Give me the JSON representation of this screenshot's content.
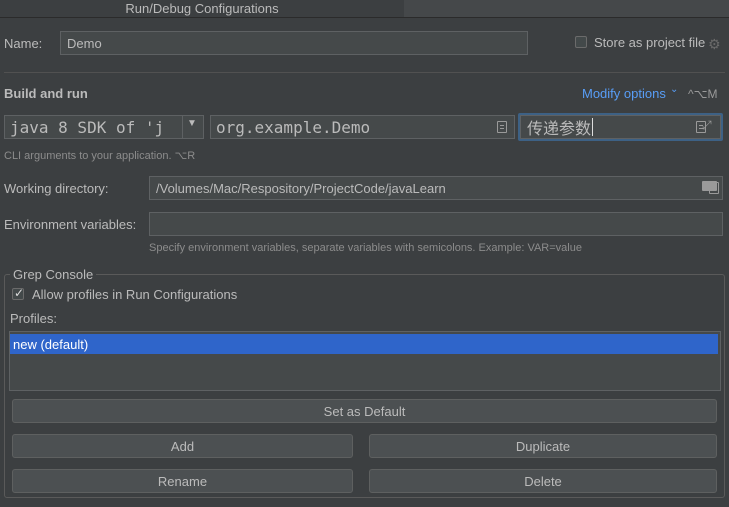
{
  "window": {
    "title": "Run/Debug Configurations"
  },
  "name_row": {
    "label": "Name:",
    "value": "Demo",
    "store_label": "Store as project file",
    "store_checked": false
  },
  "build_run": {
    "heading": "Build and run",
    "modify_options": "Modify options",
    "modify_shortcut": "^⌥M",
    "sdk_value": "java 8 SDK of 'j",
    "main_class": "org.example.Demo",
    "program_args": "传递参数",
    "cli_hint": "CLI arguments to your application. ⌥R"
  },
  "working_dir": {
    "label": "Working directory:",
    "value": "/Volumes/Mac/Respository/ProjectCode/javaLearn"
  },
  "env_vars": {
    "label": "Environment variables:",
    "value": "",
    "hint": "Specify environment variables, separate variables with semicolons. Example: VAR=value"
  },
  "grep_console": {
    "legend": "Grep Console",
    "allow_label": "Allow profiles in Run Configurations",
    "allow_checked": true,
    "profiles_label": "Profiles:",
    "profiles": [
      {
        "name": "new (default)",
        "selected": true
      }
    ],
    "buttons": {
      "set_default": "Set as Default",
      "add": "Add",
      "duplicate": "Duplicate",
      "rename": "Rename",
      "delete": "Delete"
    }
  },
  "colors": {
    "background": "#3c3f41",
    "input": "#45494a",
    "selection": "#2f65ca",
    "link": "#589df6",
    "focus": "#3d6185"
  }
}
